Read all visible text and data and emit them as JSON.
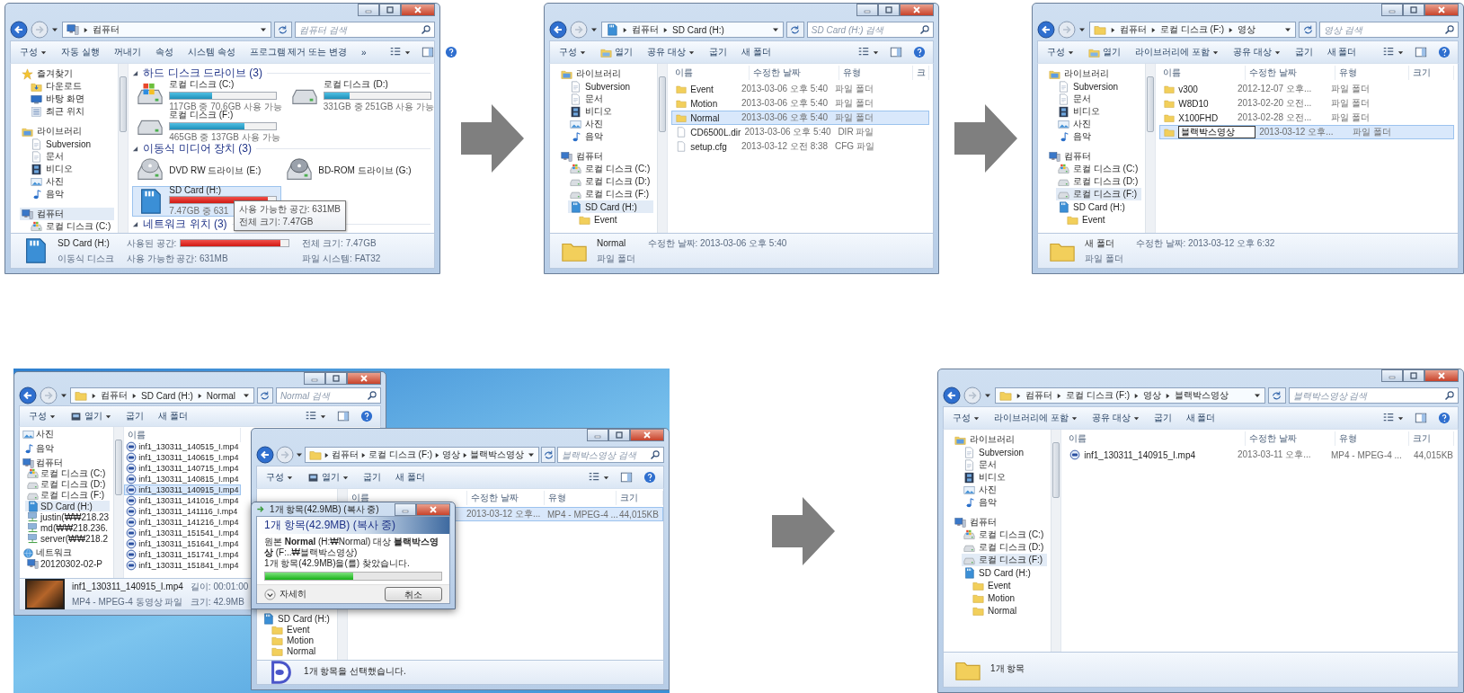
{
  "steps": [
    {
      "kind": "window",
      "window": {
        "address": [
          "컴퓨터"
        ],
        "search_placeholder": "컴퓨터 검색",
        "toolbar": [
          {
            "kind": "text",
            "label": "구성",
            "dropdown": true
          },
          {
            "kind": "text",
            "label": "자동 실행",
            "dropdown": false
          },
          {
            "kind": "text",
            "label": "꺼내기",
            "dropdown": false
          },
          {
            "kind": "text",
            "label": "속성",
            "dropdown": false
          },
          {
            "kind": "text",
            "label": "시스템 속성",
            "dropdown": false
          },
          {
            "kind": "text",
            "label": "프로그램 제거 또는 변경",
            "dropdown": false
          },
          {
            "kind": "text",
            "label": "»",
            "dropdown": false
          }
        ],
        "sidebar": [
          {
            "label": "즐겨찾기",
            "kind": "star",
            "selected": false,
            "children": [
              {
                "label": "다운로드",
                "kind": "download",
                "selected": false
              },
              {
                "label": "바탕 화면",
                "kind": "desktop",
                "selected": false
              },
              {
                "label": "최근 위치",
                "kind": "recent",
                "selected": false
              }
            ]
          },
          {
            "label": "라이브러리",
            "kind": "library",
            "selected": false,
            "children": [
              {
                "label": "Subversion",
                "kind": "document",
                "selected": false
              },
              {
                "label": "문서",
                "kind": "document",
                "selected": false
              },
              {
                "label": "비디오",
                "kind": "video",
                "selected": false
              },
              {
                "label": "사진",
                "kind": "photo",
                "selected": false
              },
              {
                "label": "음악",
                "kind": "music",
                "selected": false
              }
            ]
          },
          {
            "label": "컴퓨터",
            "kind": "computer",
            "selected": true,
            "children": [
              {
                "label": "로컬 디스크 (C:)",
                "kind": "disk-win",
                "selected": false
              }
            ]
          }
        ],
        "content": {
          "kind": "drives",
          "groups": [
            {
              "title": "하드 디스크 드라이브 (3)",
              "drives": [
                {
                  "kind": "disk-win",
                  "name": "로컬 디스크 (C:)",
                  "level": 0.4,
                  "info": "117GB 중 70.6GB 사용 가능",
                  "selected": false
                },
                {
                  "kind": "disk",
                  "name": "로컬 디스크 (D:)",
                  "level": 0.24,
                  "info": "331GB 중 251GB 사용 가능",
                  "selected": false
                },
                {
                  "kind": "disk",
                  "name": "로컬 디스크 (F:)",
                  "level": 0.7,
                  "info": "465GB 중 137GB 사용 가능",
                  "selected": false
                }
              ]
            },
            {
              "title": "이동식 미디어 장치 (3)",
              "drives": [
                {
                  "kind": "dvd",
                  "name": "DVD RW 드라이브 (E:)",
                  "selected": false
                },
                {
                  "kind": "bd",
                  "name": "BD-ROM 드라이브 (G:)",
                  "selected": false
                },
                {
                  "kind": "sd",
                  "name": "SD Card (H:)",
                  "level": 0.92,
                  "info": "7.47GB 중 631",
                  "selected": true,
                  "tooltip": [
                    "사용 가능한 공간: 631MB",
                    "전체 크기: 7.47GB"
                  ]
                }
              ]
            },
            {
              "title": "네트워크 위치 (3)"
            }
          ]
        },
        "details": {
          "kind": "sd",
          "cells": [
            "SD Card (H:)",
            "이동식 디스크",
            {
              "text": "사용된 공간:",
              "level": 0.92
            },
            "사용 가능한 공간: 631MB",
            "전체 크기: 7.47GB",
            "파일 시스템: FAT32"
          ]
        }
      }
    },
    {
      "kind": "window",
      "window": {
        "address": [
          "컴퓨터",
          "SD Card (H:)"
        ],
        "search_placeholder": "SD Card (H:) 검색",
        "toolbar": [
          {
            "kind": "text",
            "label": "구성",
            "dropdown": true
          },
          {
            "kind": "open",
            "label": "열기",
            "dropdown": false
          },
          {
            "kind": "text",
            "label": "공유 대상",
            "dropdown": true
          },
          {
            "kind": "text",
            "label": "굽기",
            "dropdown": false
          },
          {
            "kind": "text",
            "label": "새 폴더",
            "dropdown": false
          }
        ],
        "sidebar": [
          {
            "label": "라이브러리",
            "kind": "library",
            "selected": false,
            "children": [
              {
                "label": "Subversion",
                "kind": "document",
                "selected": false
              },
              {
                "label": "문서",
                "kind": "document",
                "selected": false
              },
              {
                "label": "비디오",
                "kind": "video",
                "selected": false
              },
              {
                "label": "사진",
                "kind": "photo",
                "selected": false
              },
              {
                "label": "음악",
                "kind": "music",
                "selected": false
              }
            ]
          },
          {
            "label": "컴퓨터",
            "kind": "computer",
            "selected": false,
            "children": [
              {
                "label": "로컬 디스크 (C:)",
                "kind": "disk-win",
                "selected": false
              },
              {
                "label": "로컬 디스크 (D:)",
                "kind": "disk",
                "selected": false
              },
              {
                "label": "로컬 디스크 (F:)",
                "kind": "disk",
                "selected": false
              },
              {
                "label": "SD Card (H:)",
                "kind": "sd",
                "selected": true,
                "children": [
                  {
                    "label": "Event",
                    "kind": "folder",
                    "selected": false
                  }
                ]
              }
            ]
          }
        ],
        "content": {
          "kind": "list",
          "columns": [
            "이름",
            "수정한 날짜",
            "유형",
            "크"
          ],
          "rows": [
            {
              "kind": "folder",
              "name": "Event",
              "date": "2013-03-06 오후 5:40",
              "type": "파일 폴더",
              "selected": false
            },
            {
              "kind": "folder",
              "name": "Motion",
              "date": "2013-03-06 오후 5:40",
              "type": "파일 폴더",
              "selected": false
            },
            {
              "kind": "folder",
              "name": "Normal",
              "date": "2013-03-06 오후 5:40",
              "type": "파일 폴더",
              "selected": true
            },
            {
              "kind": "file",
              "name": "CD6500L.dir",
              "date": "2013-03-06 오후 5:40",
              "type": "DIR 파일",
              "selected": false
            },
            {
              "kind": "file",
              "name": "setup.cfg",
              "date": "2013-03-12 오전 8:38",
              "type": "CFG 파일",
              "selected": false
            }
          ]
        },
        "details": {
          "kind": "folder",
          "cells": [
            "Normal",
            "파일 폴더",
            "수정한 날짜: 2013-03-06 오후 5:40"
          ]
        }
      }
    },
    {
      "kind": "window",
      "window": {
        "address": [
          "컴퓨터",
          "로컬 디스크 (F:)",
          "영상"
        ],
        "search_placeholder": "영상 검색",
        "toolbar": [
          {
            "kind": "text",
            "label": "구성",
            "dropdown": true
          },
          {
            "kind": "open",
            "label": "열기",
            "dropdown": false
          },
          {
            "kind": "text",
            "label": "라이브러리에 포함",
            "dropdown": true
          },
          {
            "kind": "text",
            "label": "공유 대상",
            "dropdown": true
          },
          {
            "kind": "text",
            "label": "굽기",
            "dropdown": false
          },
          {
            "kind": "text",
            "label": "새 폴더",
            "dropdown": false
          }
        ],
        "sidebar": [
          {
            "label": "라이브러리",
            "kind": "library",
            "selected": false,
            "children": [
              {
                "label": "Subversion",
                "kind": "document",
                "selected": false
              },
              {
                "label": "문서",
                "kind": "document",
                "selected": false
              },
              {
                "label": "비디오",
                "kind": "video",
                "selected": false
              },
              {
                "label": "사진",
                "kind": "photo",
                "selected": false
              },
              {
                "label": "음악",
                "kind": "music",
                "selected": false
              }
            ]
          },
          {
            "label": "컴퓨터",
            "kind": "computer",
            "selected": false,
            "children": [
              {
                "label": "로컬 디스크 (C:)",
                "kind": "disk-win",
                "selected": false
              },
              {
                "label": "로컬 디스크 (D:)",
                "kind": "disk",
                "selected": false
              },
              {
                "label": "로컬 디스크 (F:)",
                "kind": "disk",
                "selected": true
              },
              {
                "label": "SD Card (H:)",
                "kind": "sd",
                "selected": false,
                "children": [
                  {
                    "label": "Event",
                    "kind": "folder",
                    "selected": false
                  }
                ]
              }
            ]
          }
        ],
        "content": {
          "kind": "list",
          "columns": [
            "이름",
            "수정한 날짜",
            "유형",
            "크기"
          ],
          "rows": [
            {
              "kind": "folder",
              "name": "v300",
              "date": "2012-12-07 오후...",
              "type": "파일 폴더",
              "selected": false,
              "renaming": false
            },
            {
              "kind": "folder",
              "name": "W8D10",
              "date": "2013-02-20 오전...",
              "type": "파일 폴더",
              "selected": false,
              "renaming": false
            },
            {
              "kind": "folder",
              "name": "X100FHD",
              "date": "2013-02-28 오전...",
              "type": "파일 폴더",
              "selected": false,
              "renaming": false
            },
            {
              "kind": "folder",
              "name": "블랙박스영상",
              "date": "2013-03-12 오후...",
              "type": "파일 폴더",
              "selected": true,
              "renaming": true
            }
          ]
        },
        "details": {
          "kind": "folder",
          "cells": [
            "새 폴더",
            "파일 폴더",
            "수정한 날짜: 2013-03-12 오후 6:32"
          ]
        }
      }
    },
    {
      "kind": "desktop",
      "windows": [
        {
          "address": [
            "컴퓨터",
            "SD Card (H:)",
            "Normal"
          ],
          "search_placeholder": "Normal 검색",
          "toolbar": [
            {
              "kind": "text",
              "label": "구성",
              "dropdown": true
            },
            {
              "kind": "media",
              "label": "열기",
              "dropdown": true
            },
            {
              "kind": "text",
              "label": "굽기",
              "dropdown": false
            },
            {
              "kind": "text",
              "label": "새 폴더",
              "dropdown": false
            }
          ],
          "sidebar": [
            {
              "label": "사진",
              "kind": "photo",
              "selected": false
            },
            {
              "label": "음악",
              "kind": "music",
              "selected": false
            },
            {
              "label": "컴퓨터",
              "kind": "computer",
              "selected": false,
              "children": [
                {
                  "label": "로컬 디스크 (C:)",
                  "kind": "disk-win",
                  "selected": false
                },
                {
                  "label": "로컬 디스크 (D:)",
                  "kind": "disk",
                  "selected": false
                },
                {
                  "label": "로컬 디스크 (F:)",
                  "kind": "disk",
                  "selected": false
                },
                {
                  "label": "SD Card (H:)",
                  "kind": "sd",
                  "selected": true
                },
                {
                  "label": "justin(₩₩218.23",
                  "kind": "netdrive",
                  "selected": false
                },
                {
                  "label": "md(₩₩218.236.",
                  "kind": "netdrive",
                  "selected": false
                },
                {
                  "label": "server(₩₩218.2",
                  "kind": "netdrive",
                  "selected": false
                }
              ]
            },
            {
              "label": "네트워크",
              "kind": "network",
              "selected": false,
              "children": [
                {
                  "label": "20120302-02-P",
                  "kind": "computer",
                  "selected": false
                }
              ]
            }
          ],
          "content": {
            "kind": "list",
            "columns": [
              "이름"
            ],
            "rows": [
              {
                "kind": "video-file",
                "name": "inf1_130311_140515_I.mp4",
                "selected": false
              },
              {
                "kind": "video-file",
                "name": "inf1_130311_140615_I.mp4",
                "selected": false
              },
              {
                "kind": "video-file",
                "name": "inf1_130311_140715_I.mp4",
                "selected": false
              },
              {
                "kind": "video-file",
                "name": "inf1_130311_140815_I.mp4",
                "selected": false
              },
              {
                "kind": "video-file",
                "name": "inf1_130311_140915_I.mp4",
                "selected": true
              },
              {
                "kind": "video-file",
                "name": "inf1_130311_141016_I.mp4",
                "selected": false
              },
              {
                "kind": "video-file",
                "name": "inf1_130311_141116_I.mp4",
                "selected": false
              },
              {
                "kind": "video-file",
                "name": "inf1_130311_141216_I.mp4",
                "selected": false
              },
              {
                "kind": "video-file",
                "name": "inf1_130311_151541_I.mp4",
                "selected": false
              },
              {
                "kind": "video-file",
                "name": "inf1_130311_151641_I.mp4",
                "selected": false
              },
              {
                "kind": "video-file",
                "name": "inf1_130311_151741_I.mp4",
                "selected": false
              },
              {
                "kind": "video-file",
                "name": "inf1_130311_151841_I.mp4",
                "selected": false
              }
            ]
          },
          "details": {
            "kind": "video-thumb",
            "cells": [
              "inf1_130311_140915_I.mp4",
              "MP4 - MPEG-4 동영상 파일",
              "길이: 00:01:00",
              "크기: 42.9MB"
            ]
          }
        },
        {
          "address": [
            "컴퓨터",
            "로컬 디스크 (F:)",
            "영상",
            "블랙박스영상"
          ],
          "search_placeholder": "블랙박스영상 검색",
          "toolbar": [
            {
              "kind": "text",
              "label": "구성",
              "dropdown": true
            },
            {
              "kind": "media",
              "label": "열기",
              "dropdown": true
            },
            {
              "kind": "text",
              "label": "굽기",
              "dropdown": false
            },
            {
              "kind": "text",
              "label": "새 폴더",
              "dropdown": false
            }
          ],
          "sidebar": [
            {
              "label": "SD Card (H:)",
              "kind": "sd",
              "selected": false,
              "children": [
                {
                  "label": "Event",
                  "kind": "folder",
                  "selected": false
                },
                {
                  "label": "Motion",
                  "kind": "folder",
                  "selected": false
                },
                {
                  "label": "Normal",
                  "kind": "folder",
                  "selected": false
                }
              ]
            }
          ],
          "content": {
            "kind": "list",
            "columns": [
              "이름",
              "수정한 날짜",
              "유형",
              "크기"
            ],
            "rows": [
              {
                "date": "2013-03-12 오후...",
                "type": "MP4 - MPEG-4 ...",
                "size": "44,015KB",
                "selected": true
              }
            ]
          },
          "details": {
            "kind": "media",
            "cells": [
              "1개 항목을 선택했습니다."
            ]
          }
        }
      ],
      "dialog": {
        "title": "1개 항목(42.9MB) (복사 중)",
        "heading": "1개 항목(42.9MB) (복사 중)",
        "message": "원본 **Normal** (H:₩Normal) 대상 **블랙박스영상** (F:..₩블랙박스영상)",
        "status": "1개 항목(42.9MB)을(를) 찾았습니다.",
        "level": 0.5,
        "details_label": "자세히",
        "cancel_label": "취소"
      }
    },
    {
      "kind": "window",
      "window": {
        "address": [
          "컴퓨터",
          "로컬 디스크 (F:)",
          "영상",
          "블랙박스영상"
        ],
        "search_placeholder": "블랙박스영상 검색",
        "toolbar": [
          {
            "kind": "text",
            "label": "구성",
            "dropdown": true
          },
          {
            "kind": "text",
            "label": "라이브러리에 포함",
            "dropdown": true
          },
          {
            "kind": "text",
            "label": "공유 대상",
            "dropdown": true
          },
          {
            "kind": "text",
            "label": "굽기",
            "dropdown": false
          },
          {
            "kind": "text",
            "label": "새 폴더",
            "dropdown": false
          }
        ],
        "sidebar": [
          {
            "label": "라이브러리",
            "kind": "library",
            "selected": false,
            "children": [
              {
                "label": "Subversion",
                "kind": "document",
                "selected": false
              },
              {
                "label": "문서",
                "kind": "document",
                "selected": false
              },
              {
                "label": "비디오",
                "kind": "video",
                "selected": false
              },
              {
                "label": "사진",
                "kind": "photo",
                "selected": false
              },
              {
                "label": "음악",
                "kind": "music",
                "selected": false
              }
            ]
          },
          {
            "label": "컴퓨터",
            "kind": "computer",
            "selected": false,
            "children": [
              {
                "label": "로컬 디스크 (C:)",
                "kind": "disk-win",
                "selected": false
              },
              {
                "label": "로컬 디스크 (D:)",
                "kind": "disk",
                "selected": false
              },
              {
                "label": "로컬 디스크 (F:)",
                "kind": "disk",
                "selected": true
              },
              {
                "label": "SD Card (H:)",
                "kind": "sd",
                "selected": false,
                "children": [
                  {
                    "label": "Event",
                    "kind": "folder",
                    "selected": false
                  },
                  {
                    "label": "Motion",
                    "kind": "folder",
                    "selected": false
                  },
                  {
                    "label": "Normal",
                    "kind": "folder",
                    "selected": false
                  }
                ]
              }
            ]
          }
        ],
        "content": {
          "kind": "list",
          "columns": [
            "이름",
            "수정한 날짜",
            "유형",
            "크기"
          ],
          "rows": [
            {
              "kind": "video-file",
              "name": "inf1_130311_140915_I.mp4",
              "date": "2013-03-11 오후...",
              "type": "MP4 - MPEG-4 ...",
              "size": "44,015KB",
              "selected": false
            }
          ]
        },
        "details": {
          "kind": "folder",
          "cells": [
            "1개 항목"
          ]
        }
      }
    }
  ]
}
